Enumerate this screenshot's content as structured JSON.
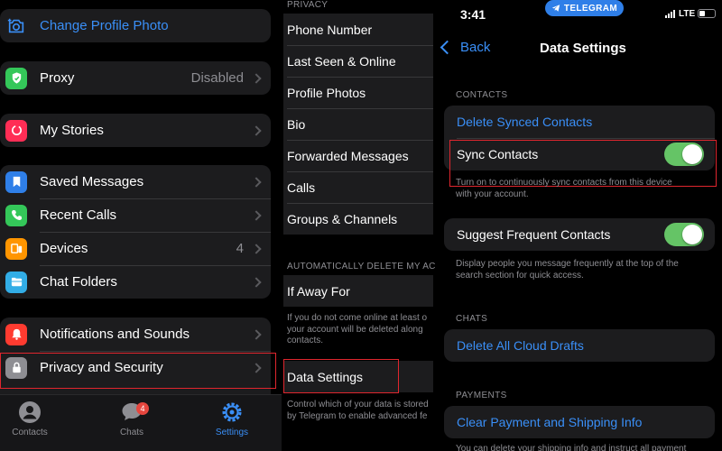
{
  "colors": {
    "accent": "#3a8ff7",
    "toggle_on": "#65c466",
    "highlight": "#e0262e",
    "badge": "#e5463e"
  },
  "panel1": {
    "top_group": [
      {
        "label": "Change Profile Photo",
        "icon": "camera-icon"
      }
    ],
    "proxy": {
      "label": "Proxy",
      "value": "Disabled",
      "icon": "shield-icon",
      "icon_color": "#34c759"
    },
    "stories": {
      "label": "My Stories",
      "icon": "stories-icon",
      "icon_color": "#ff2d55"
    },
    "group3": [
      {
        "label": "Saved Messages",
        "value": "",
        "icon": "bookmark-icon",
        "icon_color": "#2f7fe8"
      },
      {
        "label": "Recent Calls",
        "value": "",
        "icon": "phone-icon",
        "icon_color": "#34c759"
      },
      {
        "label": "Devices",
        "value": "4",
        "icon": "devices-icon",
        "icon_color": "#ff9500"
      },
      {
        "label": "Chat Folders",
        "value": "",
        "icon": "folders-icon",
        "icon_color": "#32ade6"
      }
    ],
    "group4": [
      {
        "label": "Notifications and Sounds",
        "icon": "bell-icon",
        "icon_color": "#ff3b30"
      },
      {
        "label": "Privacy and Security",
        "icon": "lock-icon",
        "icon_color": "#8e8e93"
      }
    ],
    "tabbar": {
      "contacts": "Contacts",
      "chats": "Chats",
      "chats_badge": "4",
      "settings": "Settings"
    }
  },
  "panel2": {
    "privacy_header": "PRIVACY",
    "privacy_items": [
      "Phone Number",
      "Last Seen & Online",
      "Profile Photos",
      "Bio",
      "Forwarded Messages",
      "Calls",
      "Groups & Channels"
    ],
    "auto_delete_header": "AUTOMATICALLY DELETE MY ACCO",
    "if_away": "If Away For",
    "if_away_footer": "If you do not come online at least o\nyour account will be deleted along \ncontacts.",
    "data_settings": "Data Settings",
    "data_footer": "Control which of your data is stored\nby Telegram to enable advanced fe"
  },
  "panel3": {
    "time": "3:41",
    "pill": "TELEGRAM",
    "network": "LTE",
    "back": "Back",
    "title": "Data Settings",
    "contacts_header": "CONTACTS",
    "delete_synced": "Delete Synced Contacts",
    "sync_contacts": "Sync Contacts",
    "sync_footer": "Turn on to continuously sync contacts from this device\nwith your account.",
    "suggest_frequent": "Suggest Frequent Contacts",
    "suggest_footer": "Display people you message frequently at the top of the\nsearch section for quick access.",
    "chats_header": "CHATS",
    "delete_drafts": "Delete All Cloud Drafts",
    "payments_header": "PAYMENTS",
    "clear_payment": "Clear Payment and Shipping Info",
    "payment_footer": "You can delete your shipping info and instruct all payment"
  }
}
